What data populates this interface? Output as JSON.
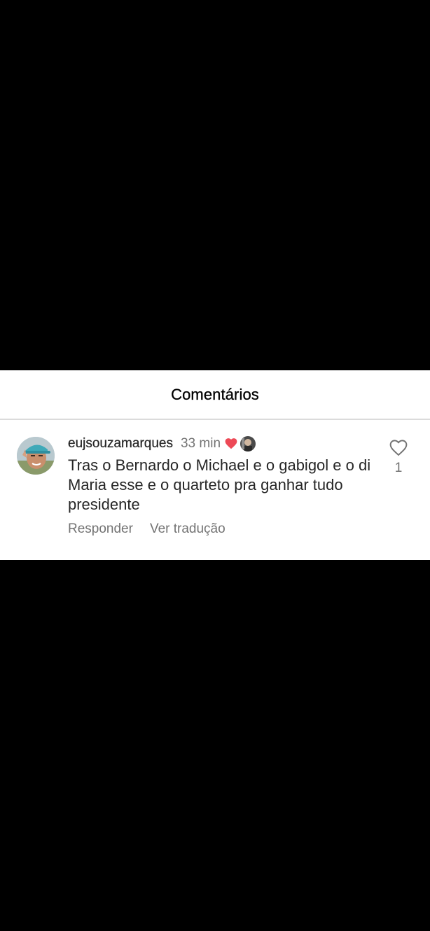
{
  "panel": {
    "title": "Comentários"
  },
  "comment": {
    "username": "eujsouzamarques",
    "time": "33 min",
    "text": "Tras o Bernardo o Michael e o gabigol  e o di Maria esse e o quarteto pra ganhar tudo presidente",
    "reply_label": "Responder",
    "translate_label": "Ver tradução",
    "like_count": "1",
    "liked_by_author": true,
    "icons": {
      "avatar": "user-avatar",
      "liked": "heart-filled-icon",
      "author": "author-avatar",
      "like": "heart-outline-icon"
    }
  },
  "colors": {
    "background": "#000000",
    "panel": "#ffffff",
    "heart_red": "#ed4956",
    "muted_text": "#737373",
    "divider": "#dbdbdb"
  }
}
